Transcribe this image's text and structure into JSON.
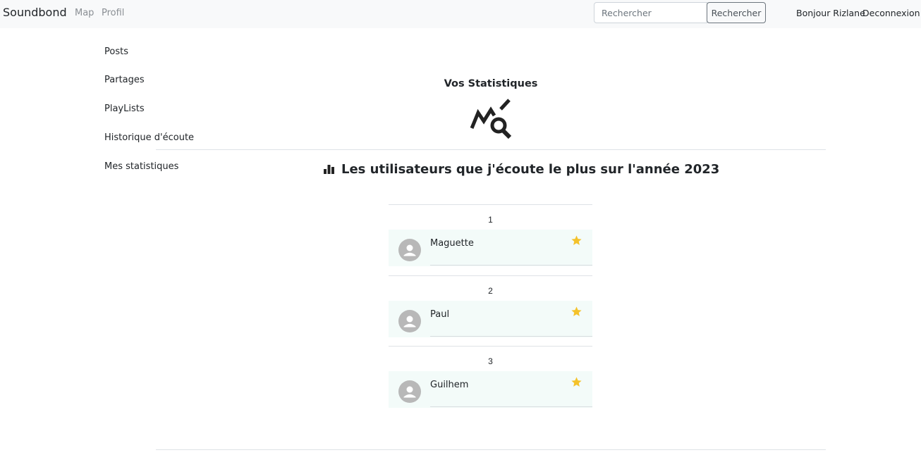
{
  "navbar": {
    "brand": "Soundbond",
    "links": [
      "Map",
      "Profil"
    ],
    "search_placeholder": "Rechercher",
    "search_button": "Rechercher",
    "greeting": "Bonjour Rizlane",
    "logout": "Deconnexion"
  },
  "sidebar": {
    "items": [
      "Posts",
      "Partages",
      "PlayLists",
      "Historique d'écoute",
      "Mes statistiques"
    ]
  },
  "stats": {
    "title": "Vos Statistiques",
    "icon": "chart-search-icon",
    "section_icon": "bar-chart-icon",
    "section_title": "Les utilisateurs que j'écoute le plus sur l'année 2023"
  },
  "ranking": [
    {
      "rank": "1",
      "name": "Maguette"
    },
    {
      "rank": "2",
      "name": "Paul"
    },
    {
      "rank": "3",
      "name": "Guilhem"
    }
  ],
  "colors": {
    "navbar_bg": "#f8f9fa",
    "card_bg": "#f3fbf9",
    "star": "#f4c22b",
    "avatar": "#b8b8b8"
  }
}
